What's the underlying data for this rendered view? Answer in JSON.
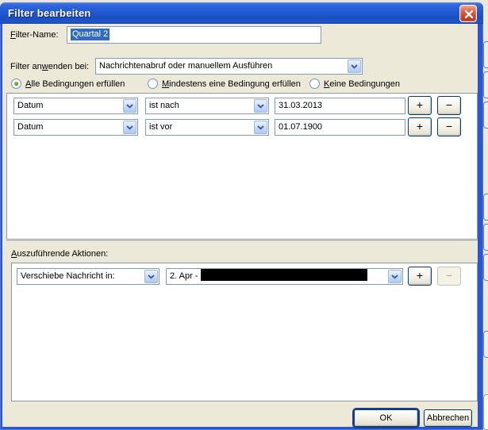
{
  "colors": {
    "titlebar_blue": "#2159D2",
    "window_border_blue": "#2A56D4",
    "selection_blue": "#316AC5",
    "client_background": "#ECE9D8",
    "close_button_red": "#D23C1F",
    "redaction_black": "#000000"
  },
  "window": {
    "title": "Filter bearbeiten"
  },
  "filter_name": {
    "label_pre": "",
    "label_key": "F",
    "label_post": "ilter-Name:",
    "value": "Quartal 2",
    "value_selected": true
  },
  "apply_when": {
    "label_pre": "Filter an",
    "label_key": "w",
    "label_post": "enden bei:",
    "value": "Nachrichtenabruf oder manuellem Ausführen"
  },
  "match": {
    "options": [
      {
        "pre": "",
        "key": "A",
        "post": "lle Bedingungen erfüllen",
        "selected": true
      },
      {
        "pre": "",
        "key": "M",
        "post": "indestens eine Bedingung erfüllen",
        "selected": false
      },
      {
        "pre": "",
        "key": "K",
        "post": "eine Bedingungen",
        "selected": false
      }
    ]
  },
  "conditions": {
    "rows": [
      {
        "field": "Datum",
        "operator": "ist nach",
        "value": "31.03.2013",
        "add_label": "+",
        "remove_label": "−"
      },
      {
        "field": "Datum",
        "operator": "ist vor",
        "value": "01.07.1900",
        "add_label": "+",
        "remove_label": "−"
      }
    ]
  },
  "actions": {
    "label_pre": "",
    "label_key": "A",
    "label_post": "uszuführende Aktionen:",
    "rows": [
      {
        "action": "Verschiebe Nachricht in:",
        "target_visible_text": "2. Apr - ",
        "target_redacted": true,
        "add_label": "+",
        "remove_label": "−"
      }
    ]
  },
  "footer": {
    "ok_label": "OK",
    "cancel_label": "Abbrechen"
  }
}
